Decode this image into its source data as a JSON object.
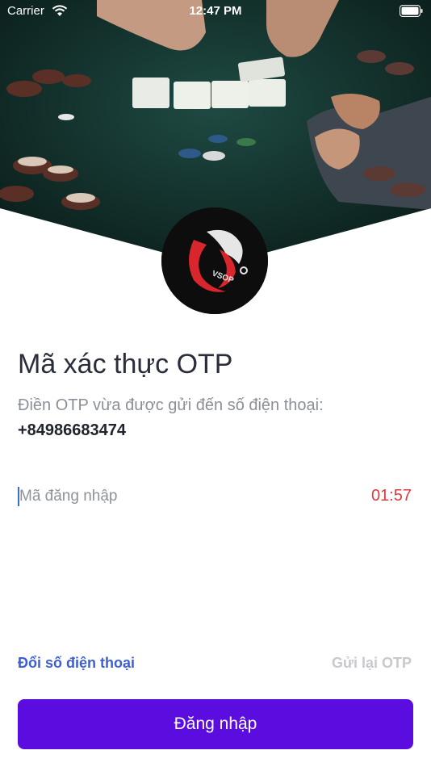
{
  "status_bar": {
    "carrier": "Carrier",
    "time": "12:47 PM",
    "icons": [
      "wifi-icon",
      "battery-icon"
    ]
  },
  "hero": {
    "image": "poker-table-photo"
  },
  "logo": {
    "name": "dragon-logo",
    "text": "VSOP"
  },
  "otp": {
    "title": "Mã xác thực OTP",
    "hint": "Điền OTP vừa được gửi đến số điện thoại:",
    "phone": "+84986683474",
    "input_placeholder": "Mã đăng nhập",
    "countdown": "01:57"
  },
  "actions": {
    "change_phone": "Đổi số điện thoại",
    "resend_otp": "Gửi lại OTP",
    "login": "Đăng nhập"
  },
  "colors": {
    "primary": "#5b0de0",
    "link": "#3d5fd3",
    "countdown": "#e0393e",
    "disabled": "#c7c9ce",
    "table_felt": "#0f2a25"
  }
}
